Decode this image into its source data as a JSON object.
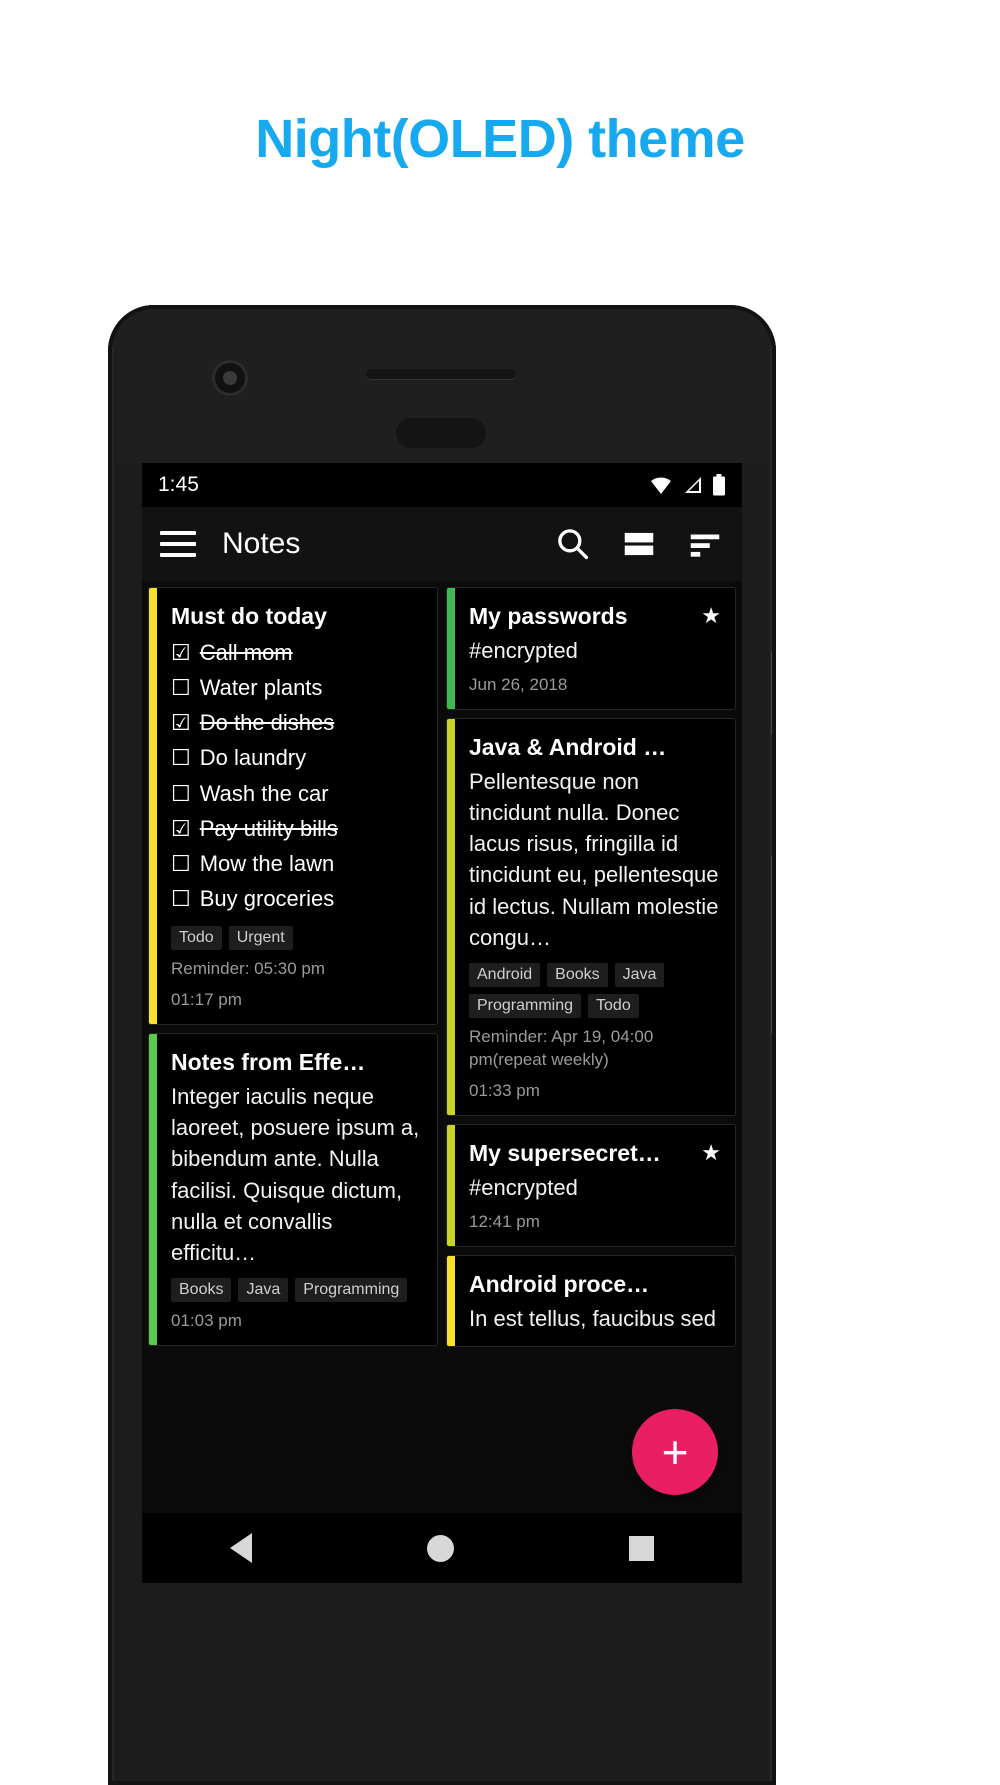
{
  "headline": "Night(OLED) theme",
  "accent_color": "#16a9f0",
  "statusbar": {
    "time": "1:45",
    "icons": [
      "wifi-icon",
      "signal-icon",
      "battery-icon"
    ]
  },
  "toolbar": {
    "menu_icon": "hamburger-menu-icon",
    "title": "Notes",
    "actions": [
      "search-icon",
      "view-mode-icon",
      "sort-icon"
    ]
  },
  "fab": {
    "label": "+"
  },
  "navbar": {
    "back": "back-icon",
    "home": "home-icon",
    "recent": "recents-icon"
  },
  "notes": {
    "left": [
      {
        "id": "must-do-today",
        "accent": "#f7e02e",
        "title": "Must do today",
        "checklist": [
          {
            "text": "Call mom",
            "checked": true
          },
          {
            "text": "Water plants",
            "checked": false
          },
          {
            "text": "Do the dishes",
            "checked": true
          },
          {
            "text": "Do laundry",
            "checked": false
          },
          {
            "text": "Wash the car",
            "checked": false
          },
          {
            "text": "Pay utility bills",
            "checked": true
          },
          {
            "text": "Mow the lawn",
            "checked": false
          },
          {
            "text": "Buy groceries",
            "checked": false
          }
        ],
        "tags": [
          "Todo",
          "Urgent"
        ],
        "reminder": "Reminder: 05:30 pm",
        "timestamp": "01:17 pm"
      },
      {
        "id": "notes-from-effective-java",
        "accent": "#5cc84e",
        "title": "Notes from Effe…",
        "body": "Integer iaculis neque laoreet, posuere ipsum a, bibendum ante. Nulla facilisi. Quisque dictum, nulla et convallis efficitu…",
        "tags": [
          "Books",
          "Java",
          "Programming"
        ],
        "timestamp": "01:03 pm"
      }
    ],
    "right": [
      {
        "id": "my-passwords",
        "accent": "#3fb950",
        "title": "My passwords",
        "body": "#encrypted",
        "timestamp": "Jun 26, 2018",
        "starred": true,
        "star_glyph": "★"
      },
      {
        "id": "java-and-android",
        "accent": "#c8d427",
        "title": "Java & Android …",
        "body": "Pellentesque non tincidunt nulla. Donec lacus risus, fringilla id tincidunt eu, pellentesque id lectus. Nullam molestie congu…",
        "tags": [
          "Android",
          "Books",
          "Java",
          "Programming",
          "Todo"
        ],
        "reminder": "Reminder: Apr 19, 04:00 pm(repeat weekly)",
        "timestamp": "01:33 pm"
      },
      {
        "id": "my-supersecret",
        "accent": "#c8d427",
        "title": "My supersecret…",
        "body": "#encrypted",
        "timestamp": "12:41 pm",
        "starred": true,
        "star_glyph": "★"
      },
      {
        "id": "android-process",
        "accent": "#f7e02e",
        "title": "Android proce…",
        "body": "In est tellus, faucibus sed"
      }
    ]
  }
}
